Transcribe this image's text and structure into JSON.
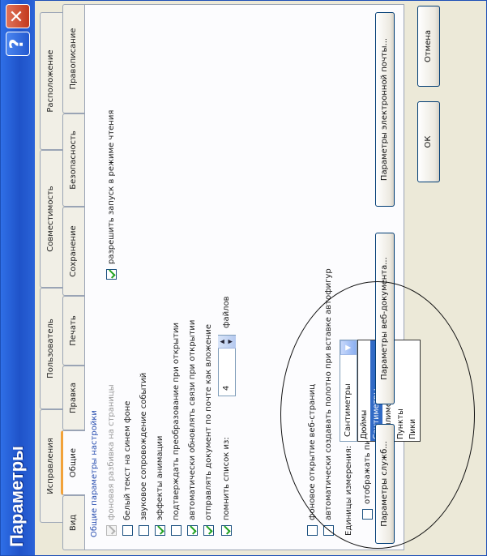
{
  "window": {
    "title": "Параметры",
    "help_label": "?",
    "close_label": "✕"
  },
  "tabs": {
    "row_back": [
      "Исправления",
      "Пользователь",
      "Совместимость",
      "Расположение"
    ],
    "row_front": [
      "Вид",
      "Общие",
      "Правка",
      "Печать",
      "Сохранение",
      "Безопасность",
      "Правописание"
    ],
    "active": "Общие"
  },
  "general": {
    "section_title": "Общие параметры настройки",
    "options": [
      {
        "label": "фоновая разбивка на страницы",
        "checked": true,
        "enabled": false
      },
      {
        "label": "белый текст на синем фоне",
        "checked": false,
        "enabled": true
      },
      {
        "label": "звуковое сопровождение событий",
        "checked": false,
        "enabled": true
      },
      {
        "label": "эффекты анимации",
        "checked": true,
        "enabled": true
      },
      {
        "label": "подтверждать преобразование при открытии",
        "checked": false,
        "enabled": true
      },
      {
        "label": "автоматически обновлять связи при открытии",
        "checked": true,
        "enabled": true
      },
      {
        "label": "отправлять документ по почте как вложение",
        "checked": true,
        "enabled": true
      },
      {
        "label": "помнить список из:",
        "checked": true,
        "enabled": true
      }
    ],
    "read_mode": {
      "label": "разрешить запуск в режиме чтения",
      "checked": true
    },
    "recent_files": {
      "value": "4",
      "suffix": "файлов"
    },
    "web_option": {
      "label": "фоновое открытие веб-страниц",
      "checked": false
    },
    "autoshape_option": {
      "label": "автоматически создавать полотно при вставке автофигур",
      "checked": false
    },
    "units": {
      "label": "Единицы измерения:",
      "selected": "Сантиметры",
      "options": [
        "Дюймы",
        "Сантиметры",
        "Миллиметры",
        "Пункты",
        "Пики"
      ],
      "highlighted": "Сантиметры"
    },
    "pixels_option": {
      "label": "отображать пиксели для",
      "checked": false
    }
  },
  "buttons": {
    "service": "Параметры служб...",
    "web_docs": "Параметры веб-документа...",
    "email": "Параметры электронной почты...",
    "ok": "ОК",
    "cancel": "Отмена"
  },
  "colors": {
    "titlebar": "#2459d6",
    "selection": "#316ac5",
    "active_tab_accent": "#f2a23a",
    "check": "#21a121"
  }
}
